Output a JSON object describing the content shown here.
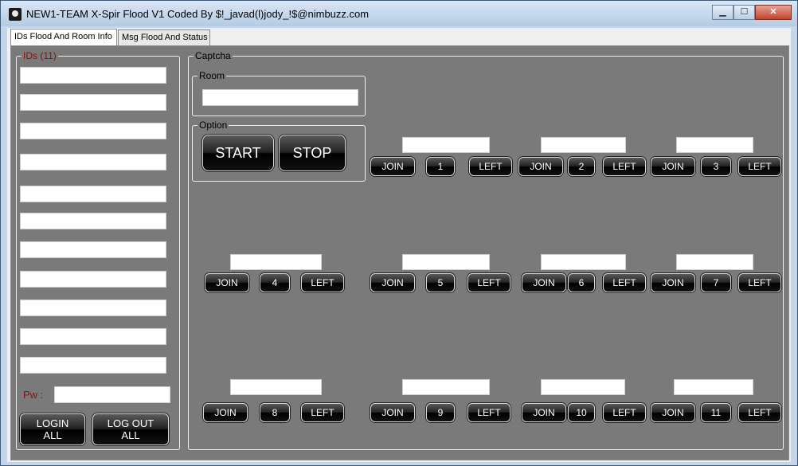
{
  "window": {
    "title": "NEW1-TEAM X-Spir Flood V1 Coded By $!_javad(l)jody_!$@nimbuzz.com",
    "minimize": "▁",
    "maximize": "☐",
    "close": "✕"
  },
  "tabs": [
    {
      "label": "IDs Flood And Room Info"
    },
    {
      "label": "Msg Flood And Status"
    }
  ],
  "ids_group": {
    "label": "IDs (11)",
    "id_fields": [
      "",
      "",
      "",
      "",
      "",
      "",
      "",
      "",
      "",
      "",
      ""
    ],
    "pw_label": "Pw :",
    "pw_value": "",
    "login_all": "LOGIN\nALL",
    "logout_all": "LOG OUT\nALL"
  },
  "captcha_group": {
    "label": "Captcha",
    "room_label": "Room",
    "room_value": "",
    "option_label": "Option",
    "start": "START",
    "stop": "STOP"
  },
  "slots": [
    {
      "number": "1",
      "join": "JOIN",
      "left": "LEFT",
      "captcha": ""
    },
    {
      "number": "2",
      "join": "JOIN",
      "left": "LEFT",
      "captcha": ""
    },
    {
      "number": "3",
      "join": "JOIN",
      "left": "LEFT",
      "captcha": ""
    },
    {
      "number": "4",
      "join": "JOIN",
      "left": "LEFT",
      "captcha": ""
    },
    {
      "number": "5",
      "join": "JOIN",
      "left": "LEFT",
      "captcha": ""
    },
    {
      "number": "6",
      "join": "JOIN",
      "left": "LEFT",
      "captcha": ""
    },
    {
      "number": "7",
      "join": "JOIN",
      "left": "LEFT",
      "captcha": ""
    },
    {
      "number": "8",
      "join": "JOIN",
      "left": "LEFT",
      "captcha": ""
    },
    {
      "number": "9",
      "join": "JOIN",
      "left": "LEFT",
      "captcha": ""
    },
    {
      "number": "10",
      "join": "JOIN",
      "left": "LEFT",
      "captcha": ""
    },
    {
      "number": "11",
      "join": "JOIN",
      "left": "LEFT",
      "captcha": ""
    }
  ]
}
